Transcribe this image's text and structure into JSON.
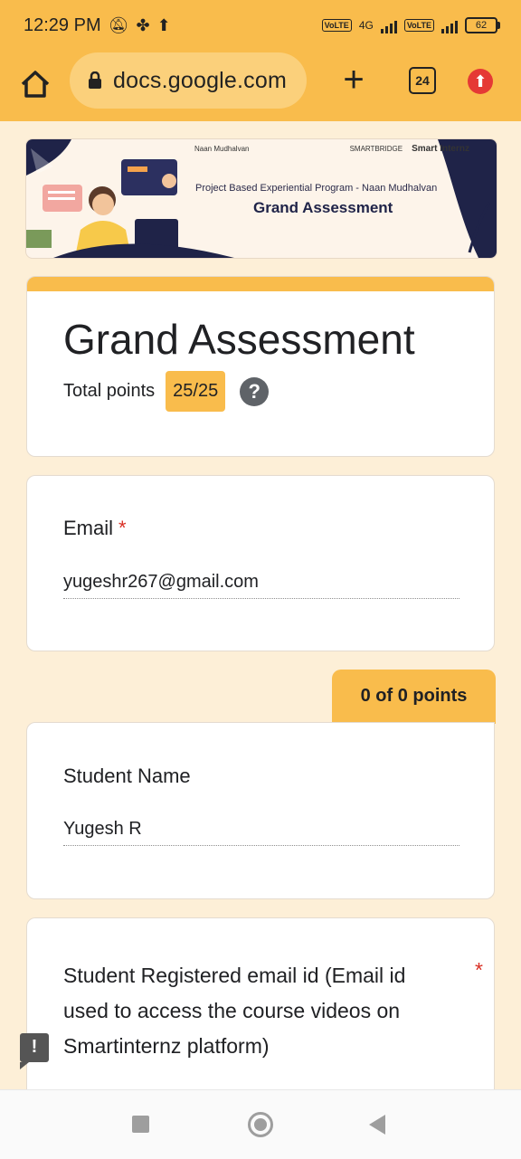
{
  "status_bar": {
    "time": "12:29 PM",
    "network": "4G",
    "battery": "62",
    "volte1": "Vo LTE",
    "volte2": "Vo LTE"
  },
  "browser": {
    "url": "docs.google.com",
    "tab_count": "24",
    "icons": [
      "home-icon",
      "lock-icon",
      "new-tab-icon",
      "tab-switcher-icon",
      "update-icon"
    ]
  },
  "banner": {
    "subtitle": "Project Based Experiential Program - Naan Mudhalvan",
    "title": "Grand Assessment",
    "logo_left": "Naan Mudhalvan",
    "logo_right_1": "SMARTBRIDGE",
    "logo_right_2": "Smart Internz"
  },
  "form": {
    "title": "Grand Assessment",
    "total_points_label": "Total points",
    "total_points_value": "25/25",
    "accent_color": "#f9bc4c"
  },
  "questions": {
    "email": {
      "label": "Email",
      "required_mark": "*",
      "answer": "yugeshr267@gmail.com"
    },
    "section_points": "0 of 0 points",
    "student_name": {
      "label": "Student Name",
      "answer": "Yugesh R"
    },
    "registered_email": {
      "label": "Student Registered email id (Email id used to access the course videos on Smartinternz platform)",
      "required_mark": "*"
    }
  }
}
